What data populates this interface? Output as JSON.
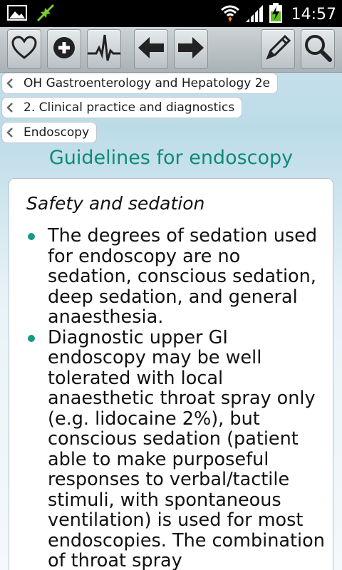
{
  "status_bar": {
    "time": "14:57",
    "icons": [
      "gallery-icon",
      "sync-icon",
      "wifi-icon",
      "signal-icon",
      "battery-charging-icon"
    ]
  },
  "toolbar": {
    "buttons": [
      {
        "name": "favorites-button",
        "icon": "heart-icon"
      },
      {
        "name": "add-button",
        "icon": "plus-circle-icon"
      },
      {
        "name": "history-button",
        "icon": "pulse-icon"
      },
      {
        "name": "back-button",
        "icon": "arrow-left-icon"
      },
      {
        "name": "forward-button",
        "icon": "arrow-right-icon"
      },
      {
        "name": "annotate-button",
        "icon": "pencil-icon"
      },
      {
        "name": "search-button",
        "icon": "magnifier-icon"
      }
    ]
  },
  "breadcrumbs": [
    {
      "label": "OH Gastroenterology and Hepatology 2e"
    },
    {
      "label": "2. Clinical practice and diagnostics"
    },
    {
      "label": "Endoscopy"
    }
  ],
  "page": {
    "title": "Guidelines for endoscopy",
    "section_title": "Safety and sedation",
    "bullets": [
      "The degrees of sedation used for endoscopy are no sedation, conscious sedation, deep sedation, and general anaesthesia.",
      "Diagnostic upper GI endoscopy may be well tolerated with local anaesthetic throat spray only (e.g. lidocaine 2%), but conscious sedation (patient able to make purposeful responses to verbal/tactile stimuli, with spontaneous ventilation) is used for most endoscopies. The combination of throat spray"
    ]
  },
  "colors": {
    "accent": "#0e8a7a",
    "bullet": "#159a84"
  }
}
